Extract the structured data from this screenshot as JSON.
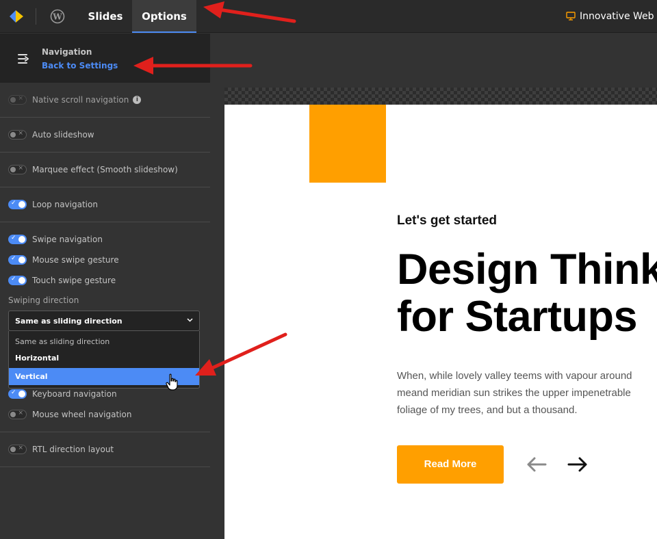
{
  "topbar": {
    "tabs": [
      {
        "label": "Slides",
        "active": false
      },
      {
        "label": "Options",
        "active": true
      }
    ],
    "project_title": "Innovative Web De"
  },
  "sidebar": {
    "section_title": "Navigation",
    "back_link": "Back to Settings",
    "options": [
      {
        "label": "Native scroll navigation",
        "on": false,
        "disabled": true
      },
      {
        "label": "Auto slideshow",
        "on": false
      },
      {
        "label": "Marquee effect (Smooth slideshow)",
        "on": false
      },
      {
        "label": "Loop navigation",
        "on": true
      },
      {
        "label": "Swipe navigation",
        "on": true
      },
      {
        "label": "Mouse swipe gesture",
        "on": true
      },
      {
        "label": "Touch swipe gesture",
        "on": true
      },
      {
        "label": "Keyboard navigation",
        "on": true
      },
      {
        "label": "Mouse wheel navigation",
        "on": false
      },
      {
        "label": "RTL direction layout",
        "on": false
      }
    ],
    "swiping_direction": {
      "label": "Swiping direction",
      "selected": "Same as sliding direction",
      "options": [
        "Same as sliding direction",
        "Horizontal",
        "Vertical"
      ],
      "highlighted": "Vertical"
    }
  },
  "slide": {
    "kicker": "Let's get started",
    "heading_line1": "Design Think",
    "heading_line2": "for Startups",
    "body_line1": "When, while lovely valley teems with vapour around",
    "body_line2": "meand meridian sun strikes the upper impenetrable",
    "body_line3": "foliage of my trees, and but a thousand.",
    "button_label": "Read More"
  },
  "colors": {
    "accent_blue": "#4c8bf5",
    "brand_orange": "#ff9f00",
    "annotation_red": "#e0201c"
  }
}
